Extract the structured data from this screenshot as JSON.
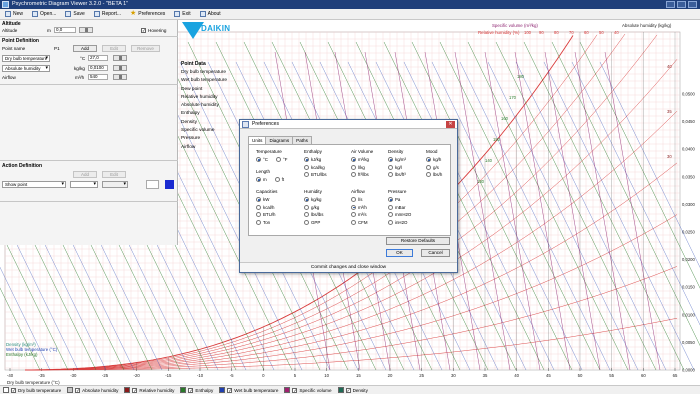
{
  "window": {
    "title": "Psychrometric Diagram Viewer 3.2.0 - \"BETA 1\""
  },
  "toolbar": {
    "items": [
      {
        "label": "New",
        "icon": "new-document-icon"
      },
      {
        "label": "Open...",
        "icon": "open-folder-icon"
      },
      {
        "label": "Save",
        "icon": "save-disk-icon"
      },
      {
        "label": "Report...",
        "icon": "report-icon"
      },
      {
        "label": "Preferences",
        "icon": "preferences-star-icon"
      },
      {
        "label": "Exit",
        "icon": "exit-icon"
      },
      {
        "label": "About",
        "icon": "about-icon"
      }
    ]
  },
  "left": {
    "altitude": {
      "section": "Altitude",
      "label": "Altitude",
      "unit": "m",
      "value": "0,0",
      "hovering_label": "Hovering",
      "hovering_checked": true
    },
    "point_def": {
      "section": "Point Definition",
      "name_label": "Point name",
      "name_value": "P1",
      "add": "Add",
      "edit": "Edit",
      "remove": "Remove",
      "param1": "Dry bulb temperature",
      "param1_unit": "°C",
      "param1_value": "27,0",
      "param2": "Absolute humidity",
      "param2_unit": "kg/kg",
      "param2_value": "0,0100",
      "airflow_label": "Airflow",
      "airflow_unit": "m³/h",
      "airflow_value": "540"
    },
    "point_data": {
      "title": "Point Data",
      "items": [
        "Dry bulb temperature",
        "Wet bulb temperature",
        "Dew point",
        "Relative humidity",
        "Absolute humidity",
        "Enthalpy",
        "Density",
        "Specific volume",
        "Pressure",
        "Airflow"
      ]
    },
    "action_def": {
      "section": "Action Definition",
      "add": "Add",
      "edit": "Edit",
      "show": "Show point"
    }
  },
  "logo": {
    "brand": "DAIKIN",
    "color": "#19a3e0"
  },
  "chart": {
    "top_labels": {
      "specific_volume": "Specific volume (m³/kg)",
      "relative_humidity": "Relative humidity (%)",
      "absolute_humidity": "Absolute humidity (kg/kg)"
    },
    "left_labels": {
      "density": "Density (kg/m³)",
      "wet_bulb": "Wet bulb temperature (°C)",
      "enthalpy": "Enthalpy (kJ/kg)"
    },
    "xlabel": "Dry bulb temperature (°C)",
    "x_ticks": [
      "-40",
      "-35",
      "-30",
      "-25",
      "-20",
      "-15",
      "-10",
      "-5",
      "0",
      "5",
      "10",
      "15",
      "20",
      "25",
      "30",
      "35",
      "40",
      "45",
      "50",
      "55",
      "60",
      "65"
    ],
    "y_ticks": [
      "0,0500",
      "0,0450",
      "0,0400",
      "0,0350",
      "0,0300",
      "0,0250",
      "0,0200",
      "0,0150",
      "0,0100",
      "0,0050",
      "0,0000"
    ],
    "rh_labels": [
      "100",
      "90",
      "80",
      "70",
      "60",
      "50",
      "40"
    ],
    "enthalpy_labels": [
      "180",
      "170",
      "160",
      "150",
      "140",
      "130"
    ],
    "right_values": [
      "40",
      "35",
      "30"
    ],
    "colors": {
      "grid": "#f2c6c6",
      "rh": "#d93a3a",
      "volume": "#8b1f6e",
      "wetbulb": "#1f3fb0",
      "enthalpy": "#2a7a2a",
      "density": "#2a8a7a",
      "dry": "#555555"
    }
  },
  "legend": {
    "items": [
      {
        "label": "Dry bulb temperature",
        "color": "#ffffff",
        "checked": true
      },
      {
        "label": "Absolute humidity",
        "color": "#c8c8c8",
        "checked": true
      },
      {
        "label": "Relative humidity",
        "color": "#8b1a1a",
        "checked": true
      },
      {
        "label": "Enthalpy",
        "color": "#2a7a2a",
        "checked": true
      },
      {
        "label": "Wet bulb temperature",
        "color": "#1f3fb0",
        "checked": true
      },
      {
        "label": "Specific volume",
        "color": "#a02070",
        "checked": true
      },
      {
        "label": "Density",
        "color": "#1f6a55",
        "checked": true
      }
    ]
  },
  "dialog": {
    "title": "Preferences",
    "tabs": [
      "Units",
      "Diagrams",
      "Paths"
    ],
    "groups": [
      {
        "heading": "Temperature",
        "options": [
          "°C",
          "°F"
        ],
        "selected": 0
      },
      {
        "heading": "Enthalpy",
        "options": [
          "kJ/kg",
          "kcal/kg",
          "BTU/lbs"
        ],
        "selected": 0
      },
      {
        "heading": "Air Volume",
        "options": [
          "m³/kg",
          "l/kg",
          "ft³/lbs"
        ],
        "selected": 0
      },
      {
        "heading": "Density",
        "options": [
          "kg/m³",
          "kg/l",
          "lbs/ft³"
        ],
        "selected": 0
      },
      {
        "heading": "Mood",
        "options": [
          "kg/h",
          "g/s",
          "lbs/h"
        ],
        "selected": 0
      },
      {
        "heading": "Length",
        "options": [
          "m",
          "ft"
        ],
        "selected": 0
      },
      {
        "heading": "Capacities",
        "options": [
          "kW",
          "kcal/h",
          "BTU/h",
          "Ton"
        ],
        "selected": 0
      },
      {
        "heading": "Humidity",
        "options": [
          "kg/kg",
          "g/kg",
          "lbs/lbs",
          "GPP"
        ],
        "selected": 0
      },
      {
        "heading": "Airflow",
        "options": [
          "l/s",
          "m³/h",
          "m³/s",
          "CFM"
        ],
        "selected": 1
      },
      {
        "heading": "Pressure",
        "options": [
          "Pa",
          "mBar",
          "mmH2O",
          "inH2O"
        ],
        "selected": 0
      }
    ],
    "restore": "Restore Defaults",
    "ok": "OK",
    "cancel": "Cancel",
    "status": "Commit changes and close window"
  }
}
